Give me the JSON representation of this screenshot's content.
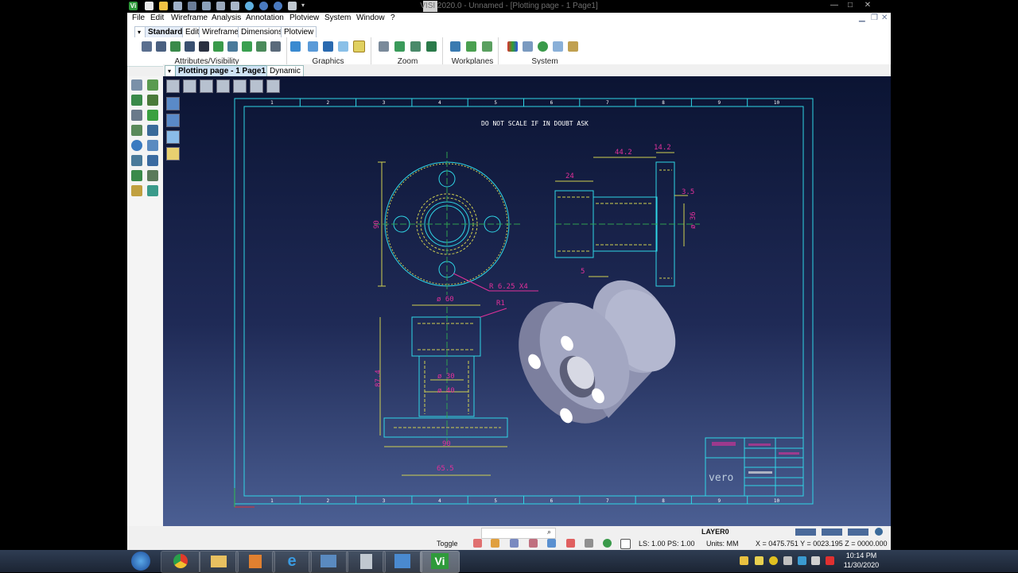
{
  "window": {
    "title": "VISI 2020.0 - Unnamed - [Plotting page - 1 Page1]",
    "controls": [
      "—",
      "□",
      "✕"
    ]
  },
  "menu": [
    "File",
    "Edit",
    "Wireframe",
    "Analysis",
    "Annotation",
    "Plotview",
    "System",
    "Window",
    "?"
  ],
  "ribbon": {
    "tabs": [
      "Standard",
      "Edit",
      "Wireframe",
      "Dimensions",
      "Plotview"
    ],
    "groups": [
      "Attributes/Visibility",
      "Graphics",
      "Zoom",
      "Workplanes",
      "System"
    ]
  },
  "doc_tabs": {
    "active": "Plotting page - 1 Page1",
    "other": "Dynamic"
  },
  "drawing": {
    "note": "DO NOT SCALE  IF IN DOUBT ASK",
    "border_columns": [
      "1",
      "2",
      "3",
      "4",
      "5",
      "6",
      "7",
      "8",
      "9",
      "10"
    ],
    "dims": {
      "d90": "90",
      "r625": "R 6.25 X4",
      "d24": "24",
      "d442": "44.2",
      "d142": "14.2",
      "d35": "3.5",
      "d36": "ø 36",
      "d5": "5",
      "d60": "ø 60",
      "r1": "R1",
      "d874": "87.4",
      "d30": "ø 30",
      "d40": "ø 40",
      "d90b": "90",
      "d655": "65.5"
    },
    "title_block": {
      "logo": "vero"
    }
  },
  "status": {
    "toggle": "Toggle",
    "layer": "LAYER0",
    "ls": "LS: 1.00 PS: 1.00",
    "units": "Units: MM",
    "coords": "X = 0475.751 Y = 0023.195 Z = 0000.000"
  },
  "taskbar": {
    "time": "10:14 PM",
    "date": "11/30/2020",
    "vi_label": "Vi"
  },
  "colors": {
    "drawing_line": "#2fd6e6",
    "dimension": "#d0d050",
    "dim_text": "#e0309a",
    "part": "#9aa0c0"
  }
}
